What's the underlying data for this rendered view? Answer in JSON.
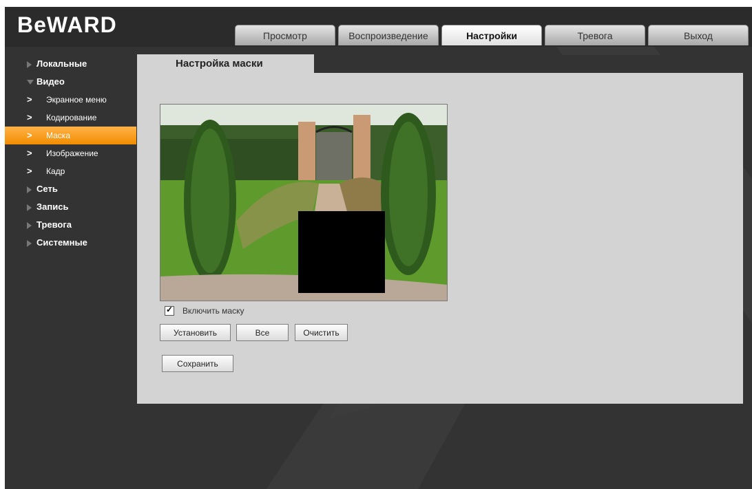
{
  "brand": {
    "logo": "BeWARD"
  },
  "nav_tabs": [
    {
      "label": "Просмотр"
    },
    {
      "label": "Воспроизведение"
    },
    {
      "label": "Настройки"
    },
    {
      "label": "Тревога"
    },
    {
      "label": "Выход"
    }
  ],
  "sidebar": {
    "local": "Локальные",
    "video": "Видео",
    "video_sub": [
      "Экранное меню",
      "Кодирование",
      "Маска",
      "Изображение",
      "Кадр"
    ],
    "network": "Сеть",
    "record": "Запись",
    "alarm": "Тревога",
    "system": "Системные"
  },
  "content": {
    "tab_title": "Настройка маски",
    "enable_mask_label": "Включить маску",
    "enable_mask_checked": true,
    "buttons": {
      "set": "Установить",
      "all": "Все",
      "clear": "Очистить",
      "save": "Сохранить"
    }
  },
  "colors": {
    "active_tab_accent": "#f28c00",
    "panel_bg": "#d3d3d3",
    "app_bg": "#333333"
  }
}
